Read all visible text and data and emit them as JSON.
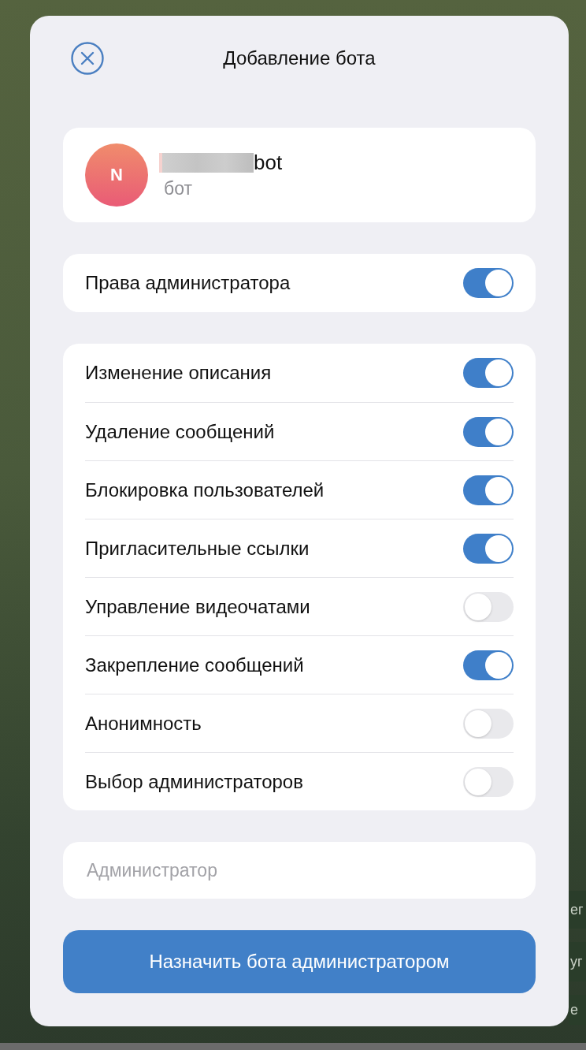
{
  "background_chat": {
    "messages": [
      {
        "text": "ег"
      },
      {
        "text": "уг"
      },
      {
        "text": "е"
      }
    ]
  },
  "dialog": {
    "title": "Добавление бота",
    "bot": {
      "avatar_letter": "N",
      "name_redacted": true,
      "name": "bot",
      "subtitle": "бот"
    },
    "admin_rights": {
      "label": "Права администратора",
      "on": true
    },
    "permissions": [
      {
        "label": "Изменение описания",
        "on": true
      },
      {
        "label": "Удаление сообщений",
        "on": true
      },
      {
        "label": "Блокировка пользователей",
        "on": true
      },
      {
        "label": "Пригласительные ссылки",
        "on": true
      },
      {
        "label": "Управление видеочатами",
        "on": false
      },
      {
        "label": "Закрепление сообщений",
        "on": true
      },
      {
        "label": "Анонимность",
        "on": false
      },
      {
        "label": "Выбор администраторов",
        "on": false
      }
    ],
    "title_field": {
      "placeholder": "Администратор"
    },
    "submit_button": "Назначить бота администратором"
  }
}
